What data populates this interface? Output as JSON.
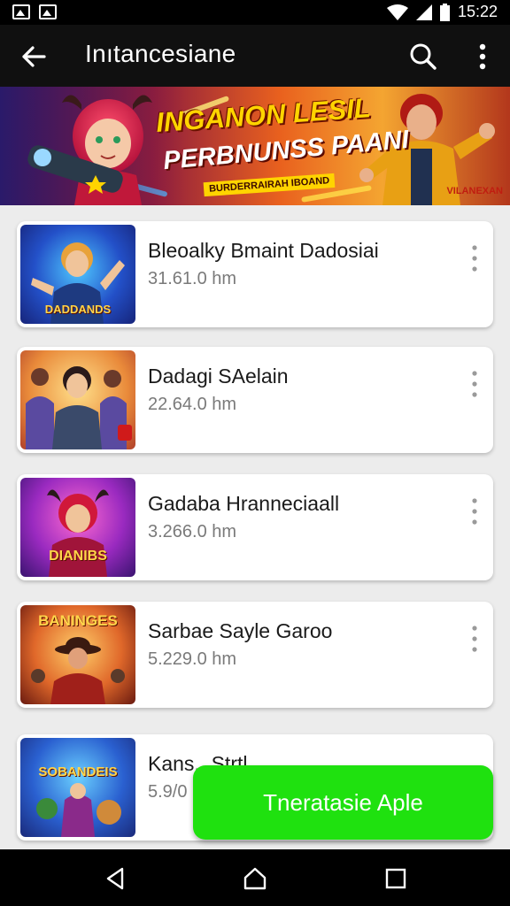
{
  "status_bar": {
    "time": "15:22"
  },
  "toolbar": {
    "title": "Inıtancesiane"
  },
  "banner": {
    "headline": "INGANON LESIL",
    "headline2": "PERBNUNSS PAANI",
    "tag": "BURDERRAIRAH IBOAND",
    "badge": "VILANEXAN"
  },
  "apps": [
    {
      "name": "Bleoalky Bmaint Dadosiai",
      "size": "31.61.0 hm",
      "thumb_title": "DADDANDS"
    },
    {
      "name": "Dadagi SAelain",
      "size": "22.64.0 hm",
      "thumb_title": ""
    },
    {
      "name": "Gadaba Hranneciaall",
      "size": "3.266.0 hm",
      "thumb_title": "DIANIBS"
    },
    {
      "name": "Sarbae Sayle Garoo",
      "size": "5.229.0 hm",
      "thumb_title": "BANINGES"
    },
    {
      "name": "Kans...Strtl",
      "size": "5.9/0",
      "thumb_title": "SOBANDEIS"
    }
  ],
  "fab": {
    "label": "Tneratasie Aple"
  },
  "colors": {
    "fab": "#1fe10f",
    "toolbar": "#101010"
  }
}
